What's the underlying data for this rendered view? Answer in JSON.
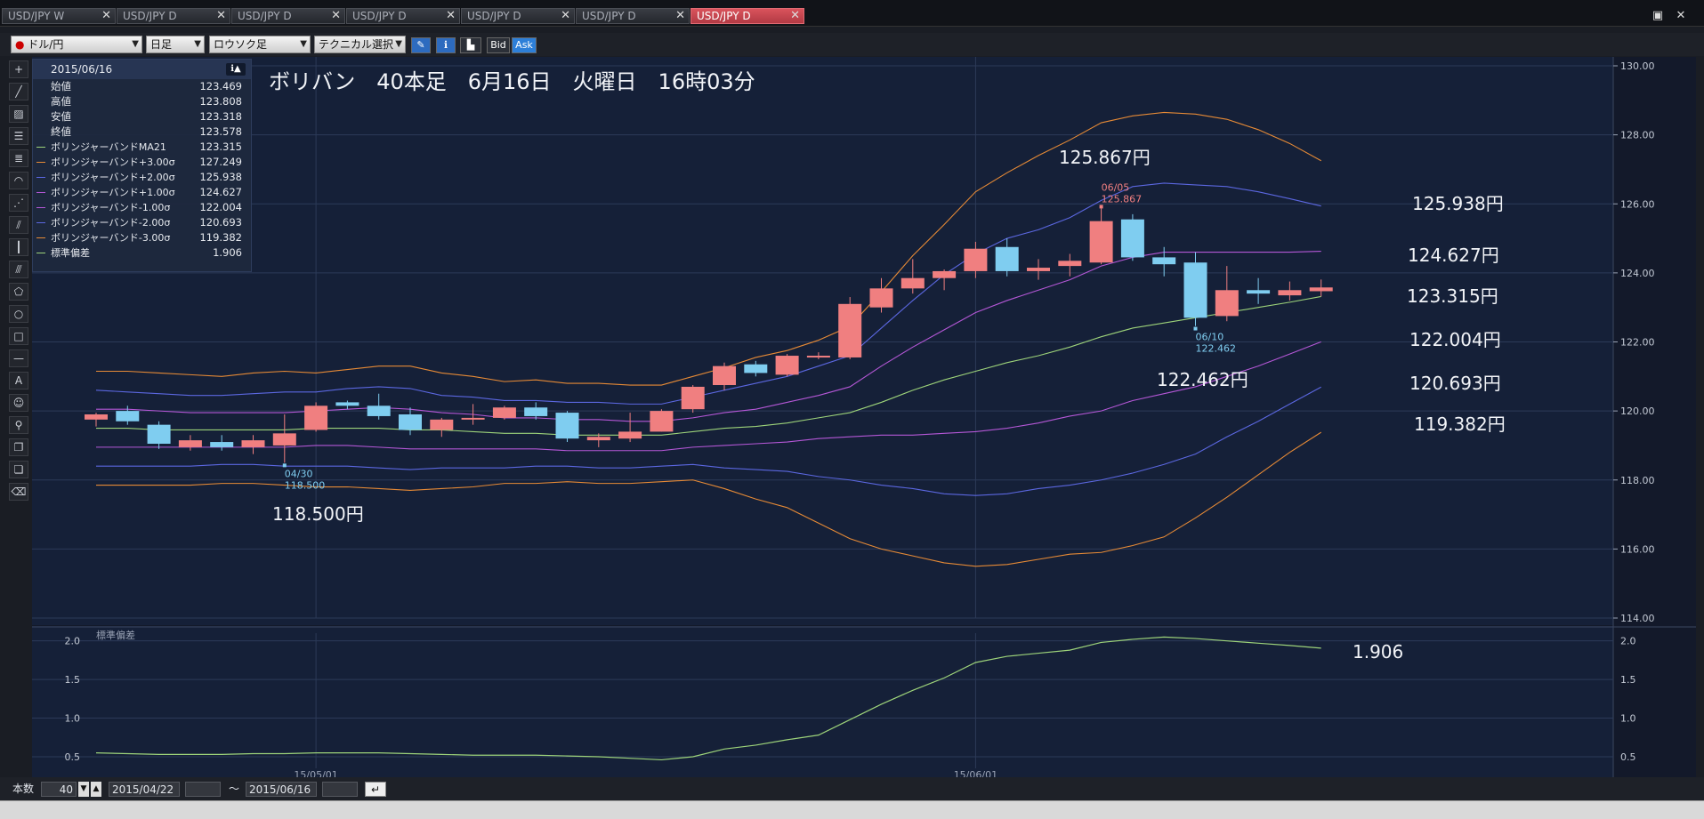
{
  "tabs": [
    {
      "label": "USD/JPY W",
      "active": false
    },
    {
      "label": "USD/JPY D",
      "active": false
    },
    {
      "label": "USD/JPY D",
      "active": false
    },
    {
      "label": "USD/JPY D",
      "active": false
    },
    {
      "label": "USD/JPY D",
      "active": false
    },
    {
      "label": "USD/JPY D",
      "active": false
    },
    {
      "label": "USD/JPY D",
      "active": true
    }
  ],
  "toolbar": {
    "symbol": "ドル/円",
    "timeframe": "日足",
    "chart_type": "ロウソク足",
    "technical": "テクニカル選択",
    "bid_label": "Bid",
    "ask_label": "Ask"
  },
  "infobox": {
    "date": "2015/06/16",
    "rows": [
      {
        "label": "始値",
        "value": "123.469"
      },
      {
        "label": "高値",
        "value": "123.808"
      },
      {
        "label": "安値",
        "value": "123.318"
      },
      {
        "label": "終値",
        "value": "123.578"
      }
    ],
    "indicators": [
      {
        "label": "ボリンジャーバンドMA21",
        "value": "123.315",
        "color": "#9dd37a"
      },
      {
        "label": "ボリンジャーバンド+3.00σ",
        "value": "127.249",
        "color": "#e68a36"
      },
      {
        "label": "ボリンジャーバンド+2.00σ",
        "value": "125.938",
        "color": "#5b67e0"
      },
      {
        "label": "ボリンジャーバンド+1.00σ",
        "value": "124.627",
        "color": "#b457d6"
      },
      {
        "label": "ボリンジャーバンド-1.00σ",
        "value": "122.004",
        "color": "#b457d6"
      },
      {
        "label": "ボリンジャーバンド-2.00σ",
        "value": "120.693",
        "color": "#5b67e0"
      },
      {
        "label": "ボリンジャーバンド-3.00σ",
        "value": "119.382",
        "color": "#e68a36"
      },
      {
        "label": "標準偏差",
        "value": "1.906",
        "color": "#9dd37a"
      }
    ]
  },
  "overlay": {
    "title": "ボリバン　40本足　6月16日　火曜日　16時03分",
    "labels": [
      "125.867円",
      "125.938円",
      "124.627円",
      "123.315円",
      "122.004円",
      "120.693円",
      "119.382円",
      "122.462円",
      "118.500円",
      "1.906"
    ]
  },
  "chart_data": {
    "type": "candlestick",
    "title": "ボリバン　40本足　6月16日　火曜日　16時03分",
    "ylim": [
      114,
      130
    ],
    "yticks": [
      "130.00",
      "128.00",
      "126.00",
      "124.00",
      "122.00",
      "120.00",
      "118.00",
      "116.00",
      "114.00"
    ],
    "colors": {
      "up": "#f07f80",
      "down": "#7fcdf0"
    },
    "candles": [
      {
        "o": 119.75,
        "h": 119.95,
        "l": 119.55,
        "c": 119.9
      },
      {
        "o": 120.0,
        "h": 120.15,
        "l": 119.6,
        "c": 119.7
      },
      {
        "o": 119.6,
        "h": 119.7,
        "l": 118.9,
        "c": 119.05
      },
      {
        "o": 118.95,
        "h": 119.3,
        "l": 118.85,
        "c": 119.15
      },
      {
        "o": 119.1,
        "h": 119.3,
        "l": 118.85,
        "c": 118.95
      },
      {
        "o": 118.95,
        "h": 119.3,
        "l": 118.75,
        "c": 119.15
      },
      {
        "o": 119.0,
        "h": 119.9,
        "l": 118.5,
        "c": 119.35
      },
      {
        "o": 119.45,
        "h": 120.25,
        "l": 119.4,
        "c": 120.15
      },
      {
        "o": 120.25,
        "h": 120.3,
        "l": 120.05,
        "c": 120.15
      },
      {
        "o": 120.15,
        "h": 120.5,
        "l": 119.75,
        "c": 119.85
      },
      {
        "o": 119.9,
        "h": 120.1,
        "l": 119.3,
        "c": 119.45
      },
      {
        "o": 119.45,
        "h": 119.8,
        "l": 119.25,
        "c": 119.75
      },
      {
        "o": 119.75,
        "h": 120.2,
        "l": 119.6,
        "c": 119.8
      },
      {
        "o": 119.8,
        "h": 120.15,
        "l": 119.75,
        "c": 120.1
      },
      {
        "o": 120.1,
        "h": 120.25,
        "l": 119.75,
        "c": 119.85
      },
      {
        "o": 119.95,
        "h": 120.0,
        "l": 119.1,
        "c": 119.2
      },
      {
        "o": 119.15,
        "h": 119.35,
        "l": 118.95,
        "c": 119.25
      },
      {
        "o": 119.2,
        "h": 119.95,
        "l": 119.1,
        "c": 119.4
      },
      {
        "o": 119.4,
        "h": 120.05,
        "l": 119.4,
        "c": 120.0
      },
      {
        "o": 120.05,
        "h": 120.75,
        "l": 119.95,
        "c": 120.7
      },
      {
        "o": 120.75,
        "h": 121.4,
        "l": 120.6,
        "c": 121.3
      },
      {
        "o": 121.35,
        "h": 121.45,
        "l": 121.0,
        "c": 121.1
      },
      {
        "o": 121.05,
        "h": 121.65,
        "l": 121.0,
        "c": 121.6
      },
      {
        "o": 121.55,
        "h": 121.7,
        "l": 121.5,
        "c": 121.6
      },
      {
        "o": 121.55,
        "h": 123.3,
        "l": 121.5,
        "c": 123.1
      },
      {
        "o": 123.0,
        "h": 123.85,
        "l": 122.85,
        "c": 123.55
      },
      {
        "o": 123.55,
        "h": 124.4,
        "l": 123.4,
        "c": 123.85
      },
      {
        "o": 123.85,
        "h": 124.1,
        "l": 123.5,
        "c": 124.05
      },
      {
        "o": 124.05,
        "h": 124.9,
        "l": 123.85,
        "c": 124.7
      },
      {
        "o": 124.75,
        "h": 125.0,
        "l": 123.9,
        "c": 124.05
      },
      {
        "o": 124.05,
        "h": 124.4,
        "l": 123.8,
        "c": 124.15
      },
      {
        "o": 124.2,
        "h": 124.55,
        "l": 123.9,
        "c": 124.35
      },
      {
        "o": 124.3,
        "h": 125.867,
        "l": 124.25,
        "c": 125.5
      },
      {
        "o": 125.55,
        "h": 125.7,
        "l": 124.35,
        "c": 124.45
      },
      {
        "o": 124.45,
        "h": 124.75,
        "l": 123.9,
        "c": 124.25
      },
      {
        "o": 124.3,
        "h": 124.6,
        "l": 122.462,
        "c": 122.7
      },
      {
        "o": 122.75,
        "h": 124.2,
        "l": 122.6,
        "c": 123.5
      },
      {
        "o": 123.5,
        "h": 123.85,
        "l": 123.1,
        "c": 123.4
      },
      {
        "o": 123.35,
        "h": 123.75,
        "l": 123.2,
        "c": 123.5
      },
      {
        "o": 123.469,
        "h": 123.808,
        "l": 123.318,
        "c": 123.578
      }
    ],
    "bands": {
      "plus3": [
        121.15,
        121.15,
        121.1,
        121.05,
        121.0,
        121.1,
        121.15,
        121.1,
        121.2,
        121.3,
        121.3,
        121.1,
        121.0,
        120.85,
        120.9,
        120.8,
        120.8,
        120.75,
        120.75,
        121.0,
        121.25,
        121.55,
        121.75,
        122.05,
        122.45,
        123.45,
        124.5,
        125.4,
        126.35,
        126.9,
        127.4,
        127.85,
        128.35,
        128.55,
        128.65,
        128.6,
        128.45,
        128.15,
        127.75,
        127.249
      ],
      "plus2": [
        120.6,
        120.55,
        120.5,
        120.45,
        120.45,
        120.5,
        120.55,
        120.55,
        120.65,
        120.7,
        120.65,
        120.45,
        120.4,
        120.3,
        120.3,
        120.25,
        120.25,
        120.2,
        120.2,
        120.4,
        120.6,
        120.8,
        121.0,
        121.3,
        121.6,
        122.4,
        123.2,
        123.95,
        124.55,
        125.0,
        125.25,
        125.6,
        126.1,
        126.5,
        126.6,
        126.55,
        126.5,
        126.35,
        126.15,
        125.938
      ],
      "plus1": [
        120.05,
        120.05,
        120.0,
        119.95,
        119.95,
        119.95,
        119.95,
        120.0,
        120.05,
        120.1,
        120.05,
        119.95,
        119.9,
        119.8,
        119.8,
        119.75,
        119.75,
        119.7,
        119.7,
        119.8,
        119.95,
        120.05,
        120.25,
        120.45,
        120.7,
        121.3,
        121.85,
        122.35,
        122.85,
        123.2,
        123.5,
        123.8,
        124.2,
        124.45,
        124.6,
        124.6,
        124.6,
        124.6,
        124.6,
        124.627
      ],
      "ma": [
        119.5,
        119.5,
        119.45,
        119.45,
        119.45,
        119.45,
        119.45,
        119.5,
        119.5,
        119.5,
        119.45,
        119.45,
        119.4,
        119.35,
        119.35,
        119.3,
        119.3,
        119.3,
        119.3,
        119.4,
        119.5,
        119.55,
        119.65,
        119.8,
        119.95,
        120.25,
        120.6,
        120.9,
        121.15,
        121.4,
        121.6,
        121.85,
        122.15,
        122.4,
        122.55,
        122.7,
        122.85,
        123.0,
        123.15,
        123.315
      ],
      "minus1": [
        118.95,
        118.95,
        118.95,
        118.95,
        118.95,
        118.95,
        118.95,
        119.0,
        119.0,
        118.95,
        118.9,
        118.9,
        118.9,
        118.9,
        118.9,
        118.85,
        118.85,
        118.85,
        118.85,
        118.95,
        119.0,
        119.05,
        119.1,
        119.2,
        119.25,
        119.3,
        119.3,
        119.35,
        119.4,
        119.5,
        119.65,
        119.85,
        120.0,
        120.3,
        120.5,
        120.7,
        121.0,
        121.3,
        121.65,
        122.004
      ],
      "minus2": [
        118.4,
        118.4,
        118.4,
        118.4,
        118.45,
        118.45,
        118.4,
        118.4,
        118.4,
        118.35,
        118.3,
        118.35,
        118.35,
        118.35,
        118.4,
        118.4,
        118.35,
        118.35,
        118.4,
        118.45,
        118.35,
        118.3,
        118.25,
        118.1,
        118.0,
        117.85,
        117.75,
        117.6,
        117.55,
        117.6,
        117.75,
        117.85,
        118.0,
        118.2,
        118.45,
        118.75,
        119.25,
        119.7,
        120.2,
        120.693
      ],
      "minus3": [
        117.85,
        117.85,
        117.85,
        117.85,
        117.9,
        117.9,
        117.85,
        117.8,
        117.8,
        117.75,
        117.7,
        117.75,
        117.8,
        117.9,
        117.9,
        117.95,
        117.9,
        117.9,
        117.95,
        118.0,
        117.75,
        117.45,
        117.2,
        116.75,
        116.3,
        116.0,
        115.8,
        115.6,
        115.5,
        115.55,
        115.7,
        115.85,
        115.9,
        116.1,
        116.35,
        116.9,
        117.5,
        118.15,
        118.8,
        119.382
      ]
    },
    "band_colors": {
      "plus3": "#e68a36",
      "plus2": "#5b67e0",
      "plus1": "#b457d6",
      "ma": "#9dd37a",
      "minus1": "#b457d6",
      "minus2": "#5b67e0",
      "minus3": "#e68a36"
    },
    "markers": [
      {
        "index": 32,
        "date": "06/05",
        "value": "125.867",
        "kind": "high"
      },
      {
        "index": 35,
        "date": "06/10",
        "value": "122.462",
        "kind": "low"
      },
      {
        "index": 6,
        "date": "04/30",
        "value": "118.500",
        "kind": "low"
      }
    ],
    "x_date_labels": [
      {
        "index": 7,
        "label": "15/05/01"
      },
      {
        "index": 28,
        "label": "15/06/01"
      }
    ],
    "sub_chart": {
      "title": "標準偏差",
      "ylim": [
        0.35,
        2.1
      ],
      "yticks": [
        "2.0",
        "1.5",
        "1.0",
        "0.5"
      ],
      "values": [
        0.55,
        0.54,
        0.53,
        0.53,
        0.53,
        0.54,
        0.54,
        0.55,
        0.55,
        0.55,
        0.54,
        0.53,
        0.52,
        0.52,
        0.52,
        0.51,
        0.5,
        0.48,
        0.46,
        0.5,
        0.6,
        0.65,
        0.72,
        0.78,
        0.98,
        1.18,
        1.36,
        1.52,
        1.72,
        1.8,
        1.84,
        1.88,
        1.98,
        2.02,
        2.05,
        2.03,
        2.0,
        1.97,
        1.94,
        1.906
      ]
    }
  },
  "bottom": {
    "count_label": "本数",
    "count": "40",
    "start": "2015/04/22",
    "tilde": "～",
    "end": "2015/06/16"
  }
}
